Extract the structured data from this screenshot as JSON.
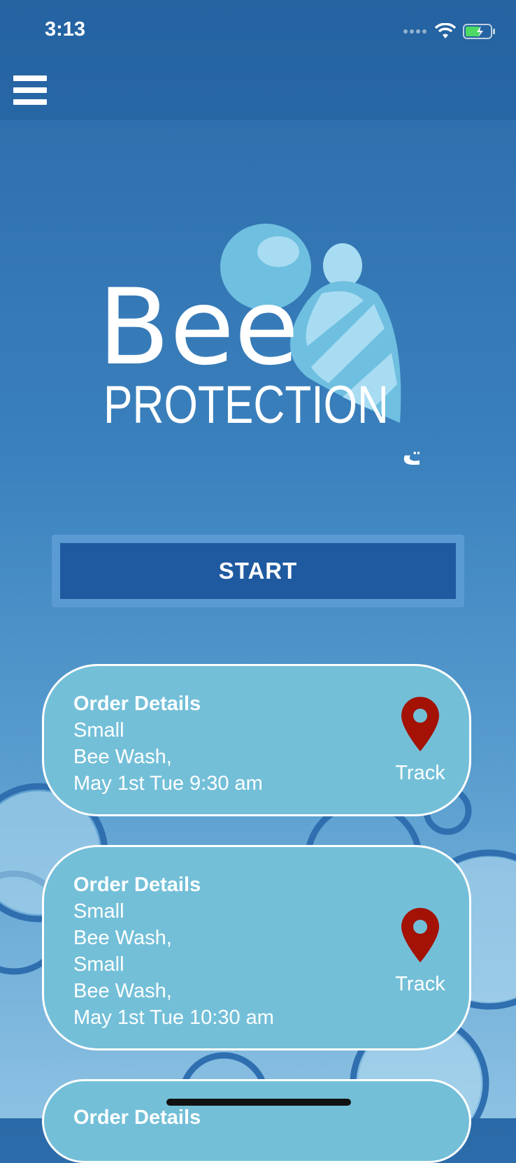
{
  "status_bar": {
    "time": "3:13"
  },
  "brand": {
    "name": "Bee",
    "subtitle": "PROTECTION",
    "tagline_ar": "لغسيل وتلميع السيارات"
  },
  "start": {
    "label": "START"
  },
  "orders": [
    {
      "title": "Order Details",
      "lines": [
        "Small",
        "Bee Wash,",
        "May 1st Tue 9:30 am"
      ],
      "track_label": "Track"
    },
    {
      "title": "Order Details",
      "lines": [
        "Small",
        "Bee Wash,",
        "Small",
        "Bee Wash,",
        "May 1st Tue 10:30 am"
      ],
      "track_label": "Track"
    },
    {
      "title": "Order Details"
    }
  ],
  "colors": {
    "accent": "#1f5aa0",
    "card": "#73bfd8",
    "pin": "#a31205"
  }
}
